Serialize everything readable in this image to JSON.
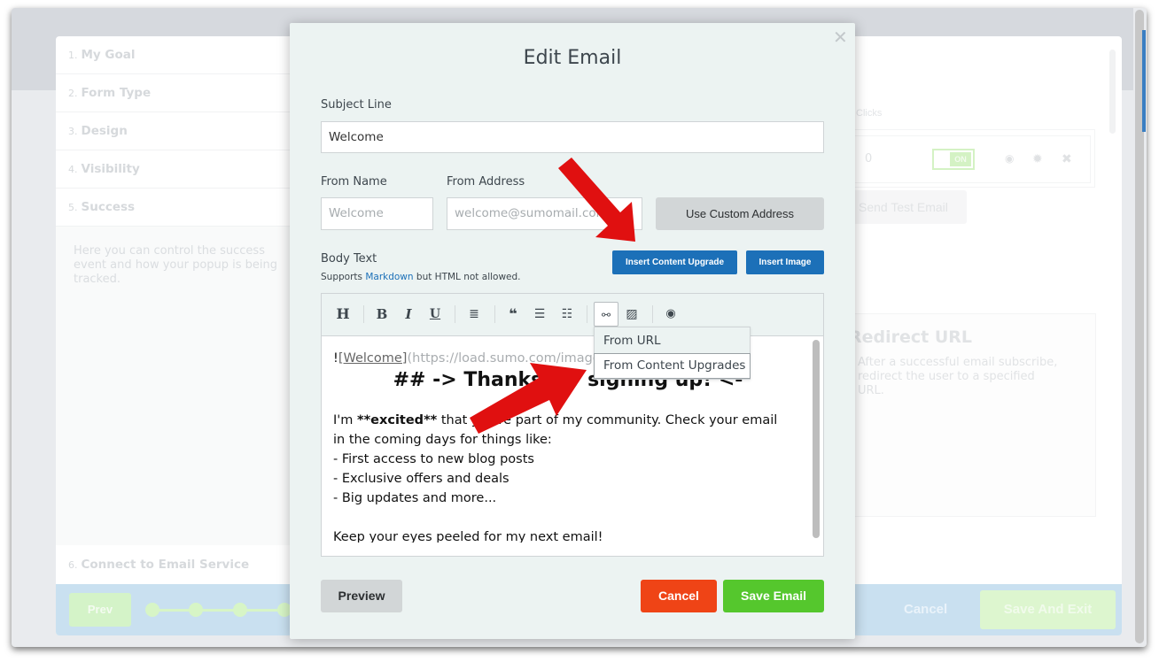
{
  "background_app": {
    "steps": [
      {
        "num": "1.",
        "label": "My Goal"
      },
      {
        "num": "2.",
        "label": "Form Type"
      },
      {
        "num": "3.",
        "label": "Design"
      },
      {
        "num": "4.",
        "label": "Visibility"
      },
      {
        "num": "5.",
        "label": "Success"
      },
      {
        "num": "6.",
        "label": "Connect to Email Service"
      }
    ],
    "success_description": "Here you can control the success event and how your popup is being tracked.",
    "clicks_label": "Clicks",
    "clicks_value": "0",
    "toggle_label": "ON",
    "send_test_label": "Send Test Email",
    "redirect_title": "Redirect URL",
    "redirect_description": "After a successful email subscribe, redirect the user to a specified URL.",
    "prev_label": "Prev",
    "cancel_label": "Cancel",
    "save_exit_label": "Save And Exit"
  },
  "modal": {
    "title": "Edit Email",
    "close_icon": "close-icon",
    "subject_label": "Subject Line",
    "subject_value": "Welcome",
    "from_name_label": "From Name",
    "from_name_placeholder": "Welcome",
    "from_address_label": "From Address",
    "from_address_placeholder": "welcome@sumomail.com",
    "custom_address_label": "Use Custom Address",
    "body_label": "Body Text",
    "body_hint_prefix": "Supports ",
    "body_hint_link": "Markdown",
    "body_hint_suffix": " but HTML not allowed.",
    "insert_upgrade_label": "Insert Content Upgrade",
    "insert_image_label": "Insert Image",
    "toolbar": [
      {
        "icon": "heading-icon",
        "glyph": "H"
      },
      {
        "icon": "bold-icon",
        "glyph": "B"
      },
      {
        "icon": "italic-icon",
        "glyph": "I"
      },
      {
        "icon": "underline-icon",
        "glyph": "U"
      },
      {
        "icon": "align-center-icon",
        "glyph": "≡"
      },
      {
        "icon": "quote-icon",
        "glyph": "❝"
      },
      {
        "icon": "bullet-list-icon",
        "glyph": "☰"
      },
      {
        "icon": "numbered-list-icon",
        "glyph": "☷"
      },
      {
        "icon": "link-icon",
        "glyph": "⚯"
      },
      {
        "icon": "image-icon",
        "glyph": "▨"
      },
      {
        "icon": "eye-icon",
        "glyph": "◉"
      }
    ],
    "link_menu": [
      "From URL",
      "From Content Upgrades"
    ],
    "body": {
      "image_bang": "!",
      "image_alt": "[Welcome]",
      "image_url": "(https://load.sumo.com/images/welcome.png)",
      "heading": "## -> Thanks for signing up! <-",
      "p1_a": "I'm ",
      "p1_bold": "**excited**",
      "p1_b": " that you're part of my community. Check your email",
      "p1_c": "in the coming days for things like:",
      "list": [
        "- First access to new blog posts",
        "- Exclusive offers and deals",
        "- Big updates and more..."
      ],
      "closing": "Keep your eyes peeled for my next email!"
    },
    "preview_label": "Preview",
    "cancel_label": "Cancel",
    "save_label": "Save Email"
  },
  "annotations": {
    "arrow_color": "#e01010",
    "arrow_count": 2
  }
}
